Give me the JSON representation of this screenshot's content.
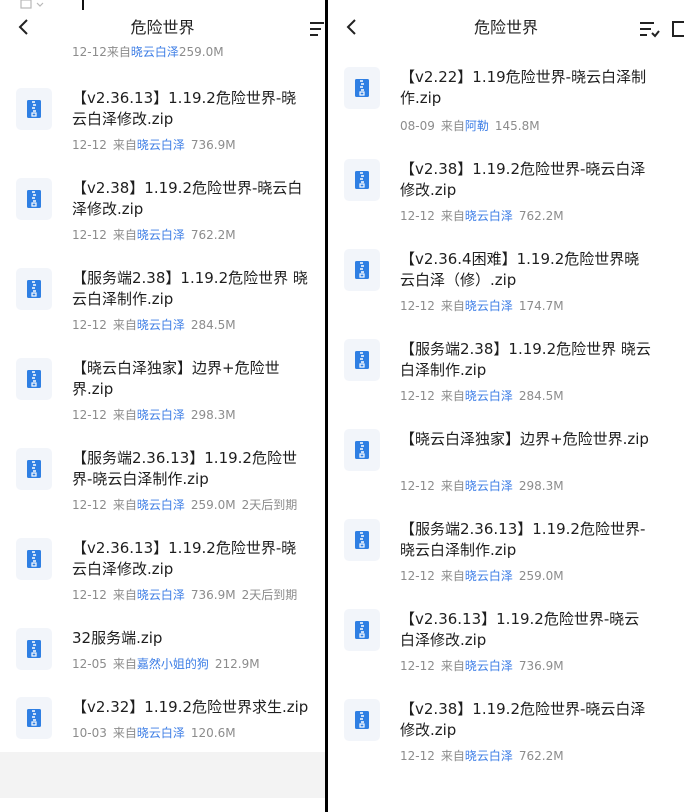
{
  "left": {
    "title": "危险世界",
    "partial_meta": {
      "date": "12-12",
      "source_prefix": "来自",
      "source": "晓云白泽",
      "size": "259.0M"
    },
    "files": [
      {
        "name": "【v2.36.13】1.19.2危险世界-晓云白泽修改.zip",
        "date": "12-12",
        "source_prefix": "来自",
        "source": "晓云白泽",
        "size": "736.9M",
        "expire": ""
      },
      {
        "name": "【v2.38】1.19.2危险世界-晓云白泽修改.zip",
        "date": "12-12",
        "source_prefix": "来自",
        "source": "晓云白泽",
        "size": "762.2M",
        "expire": ""
      },
      {
        "name": "【服务端2.38】1.19.2危险世界 晓云白泽制作.zip",
        "date": "12-12",
        "source_prefix": "来自",
        "source": "晓云白泽",
        "size": "284.5M",
        "expire": ""
      },
      {
        "name": "【晓云白泽独家】边界+危险世界.zip",
        "date": "12-12",
        "source_prefix": "来自",
        "source": "晓云白泽",
        "size": "298.3M",
        "expire": ""
      },
      {
        "name": "【服务端2.36.13】1.19.2危险世界-晓云白泽制作.zip",
        "date": "12-12",
        "source_prefix": "来自",
        "source": "晓云白泽",
        "size": "259.0M",
        "expire": "2天后到期"
      },
      {
        "name": "【v2.36.13】1.19.2危险世界-晓云白泽修改.zip",
        "date": "12-12",
        "source_prefix": "来自",
        "source": "晓云白泽",
        "size": "736.9M",
        "expire": "2天后到期"
      },
      {
        "name": "32服务端.zip",
        "date": "12-05",
        "source_prefix": "来自",
        "source": "嘉然小姐的狗",
        "size": "212.9M",
        "expire": ""
      },
      {
        "name": "【v2.32】1.19.2危险世界求生.zip",
        "date": "10-03",
        "source_prefix": "来自",
        "source": "晓云白泽",
        "size": "120.6M",
        "expire": ""
      }
    ]
  },
  "right": {
    "title": "危险世界",
    "files": [
      {
        "name": "【v2.22】1.19危险世界-晓云白泽制作.zip",
        "date": "08-09",
        "source_prefix": "来自",
        "source": "阿勒",
        "size": "145.8M",
        "expire": ""
      },
      {
        "name": "【v2.38】1.19.2危险世界-晓云白泽修改.zip",
        "date": "12-12",
        "source_prefix": "来自",
        "source": "晓云白泽",
        "size": "762.2M",
        "expire": ""
      },
      {
        "name": "【v2.36.4困难】1.19.2危险世界晓云白泽（修）.zip",
        "date": "12-12",
        "source_prefix": "来自",
        "source": "晓云白泽",
        "size": "174.7M",
        "expire": ""
      },
      {
        "name": "【服务端2.38】1.19.2危险世界 晓云白泽制作.zip",
        "date": "12-12",
        "source_prefix": "来自",
        "source": "晓云白泽",
        "size": "284.5M",
        "expire": ""
      },
      {
        "name": "【晓云白泽独家】边界+危险世界.zip",
        "date": "12-12",
        "source_prefix": "来自",
        "source": "晓云白泽",
        "size": "298.3M",
        "expire": ""
      },
      {
        "name": "【服务端2.36.13】1.19.2危险世界-晓云白泽制作.zip",
        "date": "12-12",
        "source_prefix": "来自",
        "source": "晓云白泽",
        "size": "259.0M",
        "expire": ""
      },
      {
        "name": "【v2.36.13】1.19.2危险世界-晓云白泽修改.zip",
        "date": "12-12",
        "source_prefix": "来自",
        "source": "晓云白泽",
        "size": "736.9M",
        "expire": ""
      },
      {
        "name": "【v2.38】1.19.2危险世界-晓云白泽修改.zip",
        "date": "12-12",
        "source_prefix": "来自",
        "source": "晓云白泽",
        "size": "762.2M",
        "expire": ""
      }
    ]
  },
  "colors": {
    "source_link": "#3d7ee6",
    "icon_blue": "#2f7fe3",
    "icon_bg": "#f2f5fa",
    "meta_gray": "#8c8c8c"
  },
  "icons": {
    "back": "chevron-left-icon",
    "menu": "list-menu-icon",
    "file": "zip-file-icon"
  }
}
